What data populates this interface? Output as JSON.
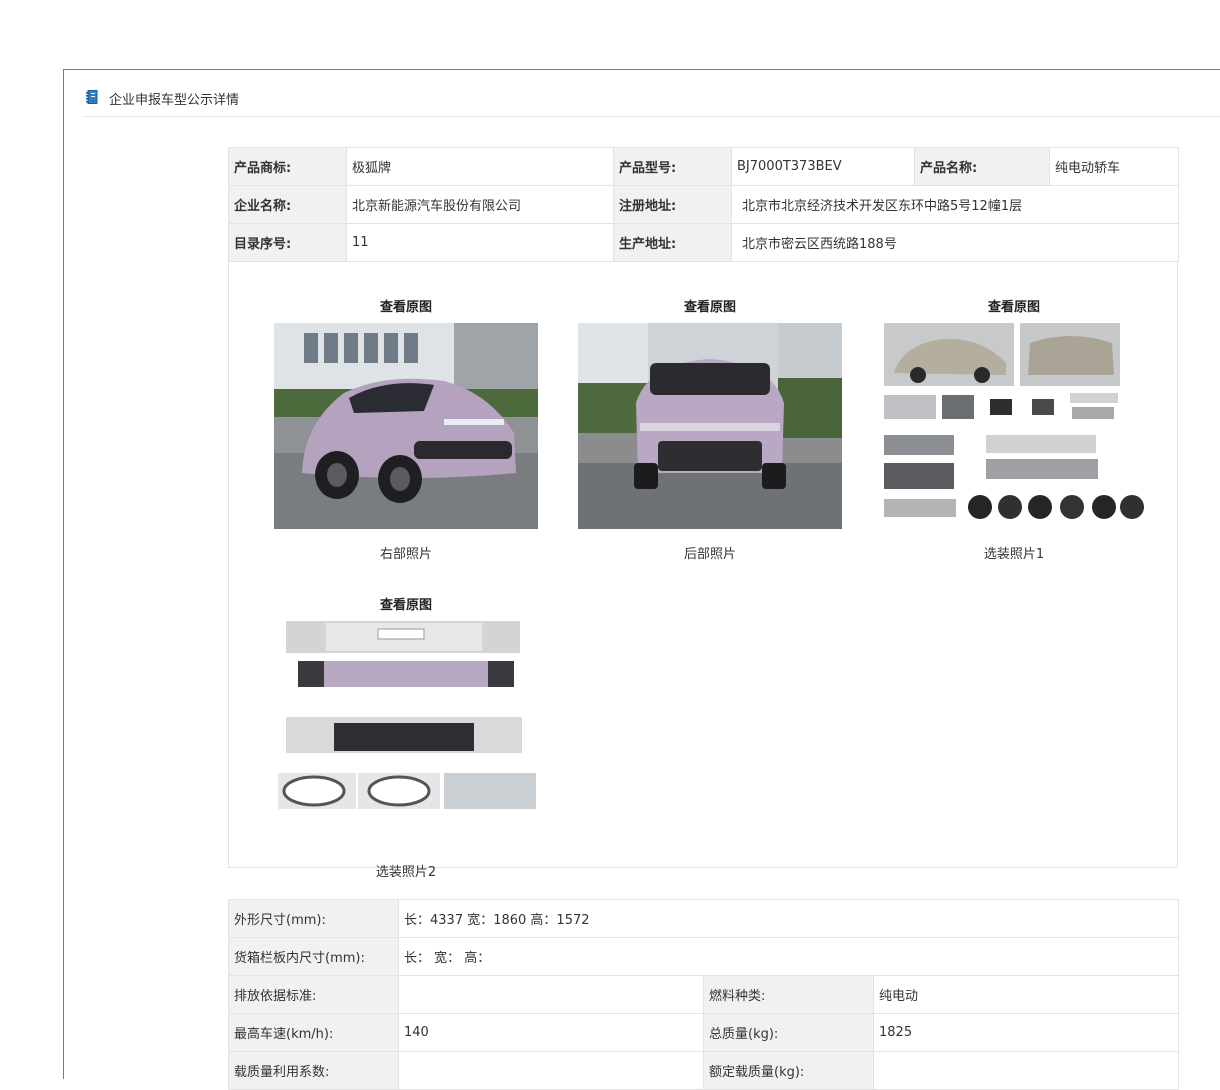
{
  "panel": {
    "title": "企业申报车型公示详情",
    "icon": "catalog-book-icon"
  },
  "info": {
    "brand_label": "产品商标:",
    "brand": "极狐牌",
    "model_label": "产品型号:",
    "model": "BJ7000T373BEV",
    "name_label": "产品名称:",
    "name": "纯电动轿车",
    "company_label": "企业名称:",
    "company": "北京新能源汽车股份有限公司",
    "reg_addr_label": "注册地址:",
    "reg_addr": "北京市北京经济技术开发区东环中路5号12幢1层",
    "catalog_label": "目录序号:",
    "catalog": "11",
    "prod_addr_label": "生产地址:",
    "prod_addr": "北京市密云区西统路188号"
  },
  "photos": [
    {
      "link": "查看原图",
      "caption": "右部照片"
    },
    {
      "link": "查看原图",
      "caption": "后部照片"
    },
    {
      "link": "查看原图",
      "caption": "选装照片1"
    },
    {
      "link": "查看原图",
      "caption": "选装照片2"
    }
  ],
  "specs": {
    "dim_label": "外形尺寸(mm):",
    "dim_value": "长：4337 宽：1860 高：1572",
    "cargo_label": "货箱栏板内尺寸(mm):",
    "cargo_value": "长：  宽：  高：",
    "emission_label": "排放依据标准:",
    "emission_value": "",
    "fuel_label": "燃料种类:",
    "fuel_value": "纯电动",
    "speed_label": "最高车速(km/h):",
    "speed_value": "140",
    "mass_label": "总质量(kg):",
    "mass_value": "1825",
    "load_util_label": "载质量利用系数:",
    "load_util_value": "",
    "rated_load_label": "额定载质量(kg):",
    "rated_load_value": ""
  },
  "colors": {
    "panel_border": "#3b8fb8",
    "label_bg": "#f1f1f1",
    "car_body": "#b5a2bf"
  }
}
